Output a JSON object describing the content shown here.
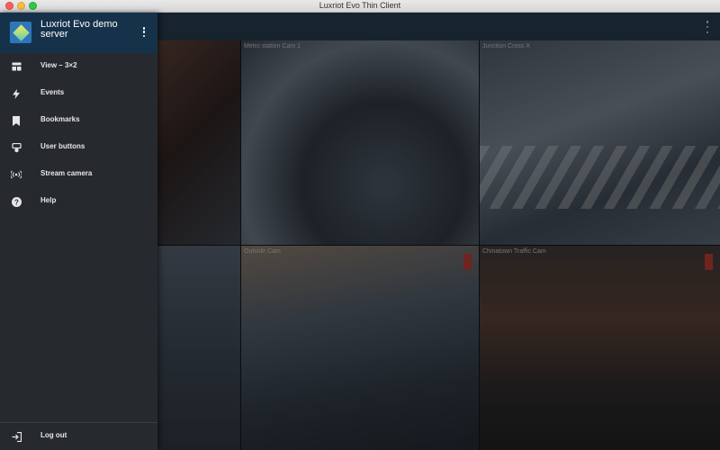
{
  "window": {
    "title": "Luxriot Evo Thin Client"
  },
  "drawer": {
    "server_name": "Luxriot Evo demo server",
    "items": [
      {
        "label": "View – 3×2",
        "icon": "grid-view-icon"
      },
      {
        "label": "Events",
        "icon": "lightning-icon"
      },
      {
        "label": "Bookmarks",
        "icon": "bookmark-icon"
      },
      {
        "label": "User buttons",
        "icon": "user-buttons-icon"
      },
      {
        "label": "Stream camera",
        "icon": "broadcast-icon"
      },
      {
        "label": "Help",
        "icon": "help-icon"
      }
    ],
    "logout_label": "Log out"
  },
  "cameras": [
    {
      "name": ""
    },
    {
      "name": "Metro station Cam 1"
    },
    {
      "name": "Junction Cross X"
    },
    {
      "name": ""
    },
    {
      "name": "Outside Cam"
    },
    {
      "name": "Chinatown Traffic Cam"
    }
  ],
  "colors": {
    "appbar": "#17232d",
    "drawer": "#262a2f",
    "drawer_header": "#16324a",
    "recording": "#c0392b"
  }
}
